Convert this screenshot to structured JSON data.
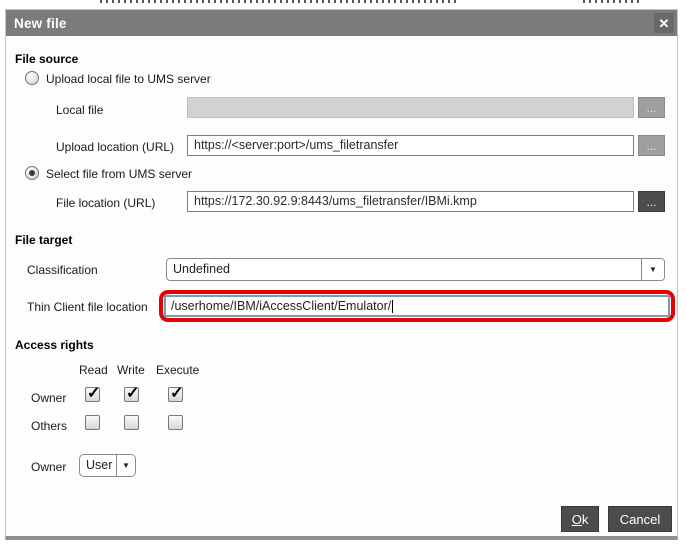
{
  "icons": {
    "close": "✕",
    "dropdown_arrow": "▼",
    "check": "✓"
  },
  "dialog": {
    "title": "New file"
  },
  "file_source": {
    "heading": "File source",
    "upload_radio_label": "Upload local file to UMS server",
    "upload_radio_selected": false,
    "local_file_label": "Local file",
    "local_file_value": "",
    "browse_label": "...",
    "upload_location_label": "Upload location (URL)",
    "upload_location_value": "https://<server:port>/ums_filetransfer",
    "select_radio_label": "Select file from UMS server",
    "select_radio_selected": true,
    "file_location_label": "File location (URL)",
    "file_location_value": "https://172.30.92.9:8443/ums_filetransfer/IBMi.kmp"
  },
  "file_target": {
    "heading": "File target",
    "classification_label": "Classification",
    "classification_value": "Undefined",
    "thin_client_label": "Thin Client file location",
    "thin_client_value": "/userhome/IBM/iAccessClient/Emulator/",
    "highlight_color": "#e60000"
  },
  "access_rights": {
    "heading": "Access rights",
    "columns": [
      "Read",
      "Write",
      "Execute"
    ],
    "rows": [
      {
        "label": "Owner",
        "read": true,
        "write": true,
        "execute": true
      },
      {
        "label": "Others",
        "read": false,
        "write": false,
        "execute": false
      }
    ],
    "owner_label": "Owner",
    "owner_value": "User"
  },
  "footer": {
    "ok_label": "Ok",
    "cancel_label": "Cancel"
  }
}
